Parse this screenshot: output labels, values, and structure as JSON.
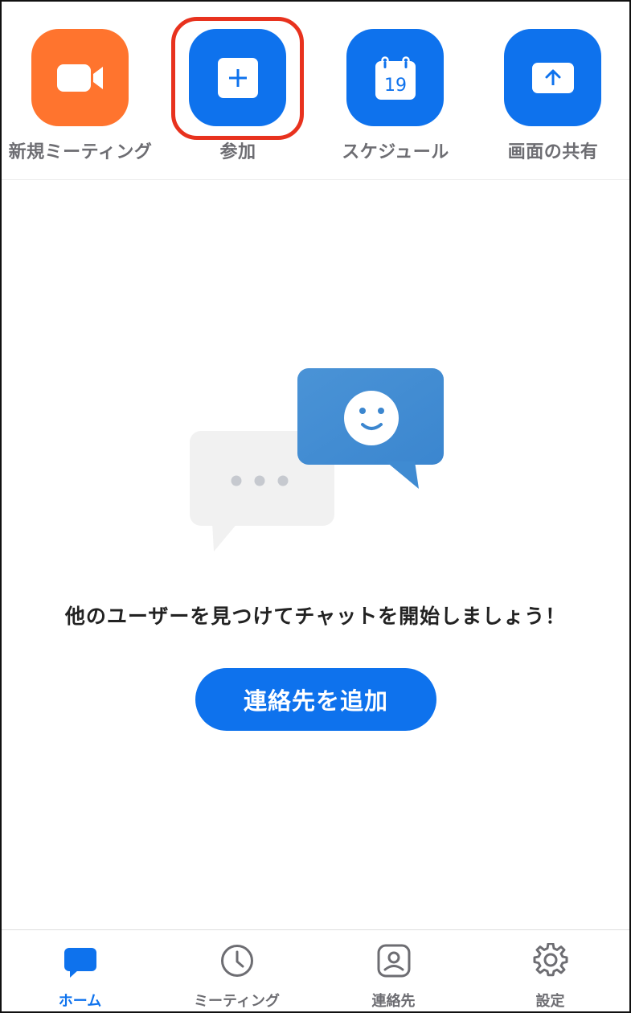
{
  "actions": [
    {
      "label": "新規ミーティング",
      "icon": "video-camera-icon",
      "color": "#ff742e"
    },
    {
      "label": "参加",
      "icon": "plus-icon",
      "color": "#0e72ed",
      "highlighted": true
    },
    {
      "label": "スケジュール",
      "icon": "calendar-icon",
      "color": "#0e72ed",
      "calendar_day": "19"
    },
    {
      "label": "画面の共有",
      "icon": "share-screen-icon",
      "color": "#0e72ed"
    }
  ],
  "empty_state": {
    "message": "他のユーザーを見つけてチャットを開始しましょう！",
    "button_label": "連絡先を追加"
  },
  "tabs": [
    {
      "label": "ホーム",
      "icon": "chat-bubble-icon",
      "active": true
    },
    {
      "label": "ミーティング",
      "icon": "clock-icon",
      "active": false
    },
    {
      "label": "連絡先",
      "icon": "contact-icon",
      "active": false
    },
    {
      "label": "設定",
      "icon": "gear-icon",
      "active": false
    }
  ],
  "colors": {
    "primary": "#0e72ed",
    "new_meeting": "#ff742e",
    "highlight": "#e8321e",
    "inactive_text": "#6d6d72"
  }
}
